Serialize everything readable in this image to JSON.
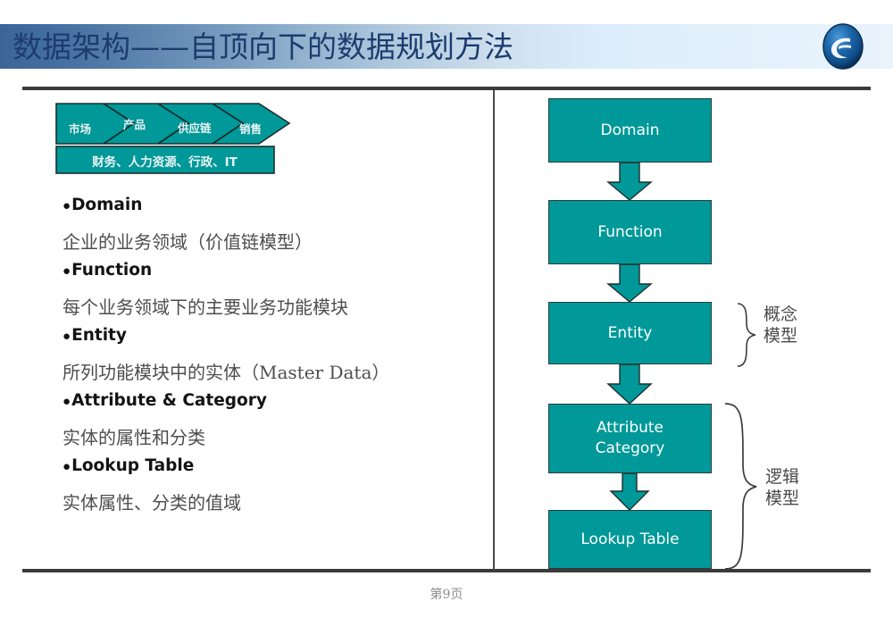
{
  "slide": {
    "title": "数据架构——自顶向下的数据规划方法",
    "footer_page": "第9页",
    "theme": {
      "teal": "#009898",
      "title_color": "#1c3c6e",
      "header_gradient_start": "#3a6596",
      "header_gradient_end": "#e8f3fc",
      "rule_color": "#3b3b3b"
    },
    "logo": "company-sphere-logo"
  },
  "value_chain": {
    "primary_segments": [
      "市场",
      "产品",
      "供应链",
      "销售"
    ],
    "support_row": "财务、人力资源、行政、IT"
  },
  "definitions": [
    {
      "term": "Domain",
      "bullet": "●",
      "description": "企业的业务领域（价值链模型）"
    },
    {
      "term": "Function",
      "bullet": "●",
      "description": "每个业务领域下的主要业务功能模块"
    },
    {
      "term": "Entity",
      "bullet": "●",
      "description": "所列功能模块中的实体（Master Data）"
    },
    {
      "term": "Attribute & Category",
      "bullet": "●",
      "description": "实体的属性和分类"
    },
    {
      "term": "Lookup Table",
      "bullet": "●",
      "description": "实体属性、分类的值域"
    }
  ],
  "flowchart": {
    "boxes": [
      {
        "label": "Domain"
      },
      {
        "label": "Function"
      },
      {
        "label": "Attribute\nCategory"
      },
      {
        "label": "Entity"
      },
      {
        "label": "Lookup Table"
      }
    ],
    "box_domain": "Domain",
    "box_function": "Function",
    "box_entity": "Entity",
    "box_attribute_line1": "Attribute",
    "box_attribute_line2": "Category",
    "box_lookup": "Lookup Table",
    "annotations": {
      "conceptual_line1": "概念",
      "conceptual_line2": "模型",
      "logical_line1": "逻辑",
      "logical_line2": "模型"
    }
  }
}
